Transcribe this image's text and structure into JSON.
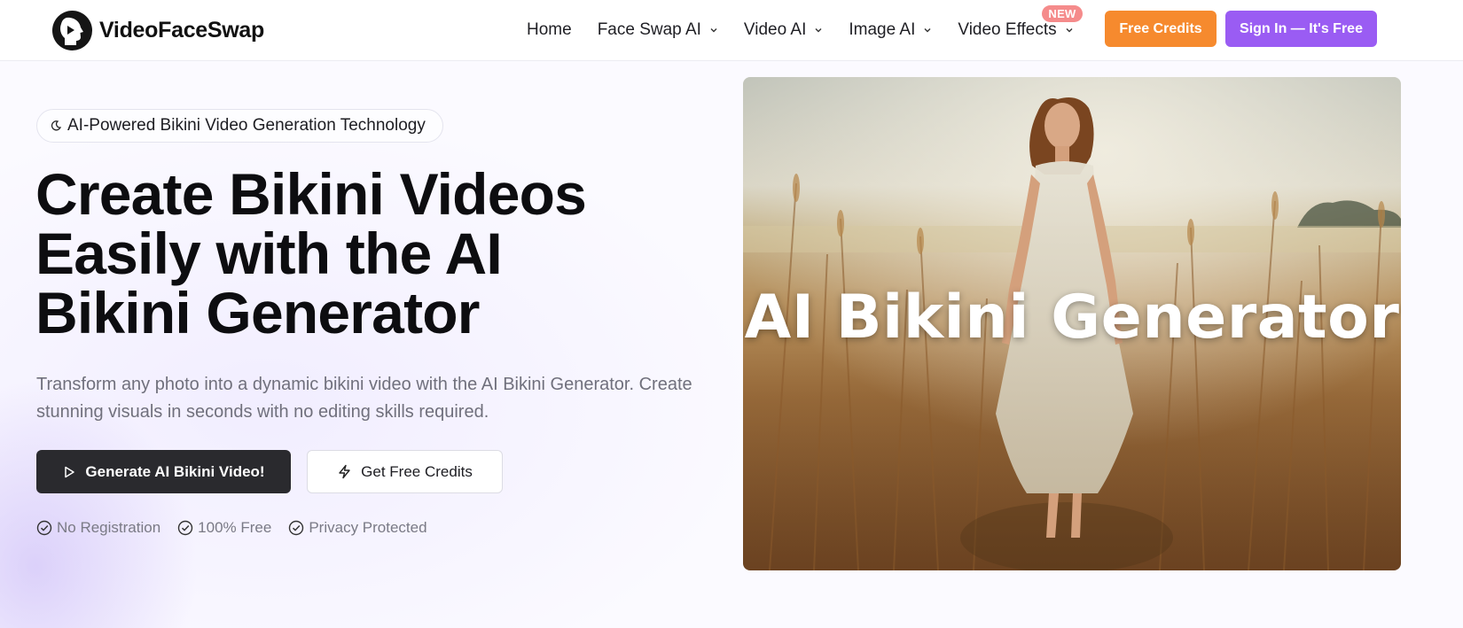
{
  "brand": {
    "name": "VideoFaceSwap"
  },
  "nav": {
    "items": [
      {
        "label": "Home",
        "has_dropdown": false
      },
      {
        "label": "Face Swap AI",
        "has_dropdown": true
      },
      {
        "label": "Video AI",
        "has_dropdown": true
      },
      {
        "label": "Image AI",
        "has_dropdown": true
      },
      {
        "label": "Video Effects",
        "has_dropdown": true,
        "badge": "NEW"
      }
    ],
    "free_credits_label": "Free Credits",
    "sign_in_label": "Sign In — It's Free"
  },
  "hero": {
    "tag": "AI-Powered Bikini Video Generation Technology",
    "title_lines": [
      "Create Bikini Videos",
      "Easily with the AI",
      "Bikini Generator"
    ],
    "subtitle": "Transform any photo into a dynamic bikini video with the AI Bikini Generator. Create stunning visuals in seconds with no editing skills required.",
    "primary_button": "Generate AI Bikini Video!",
    "secondary_button": "Get Free Credits",
    "features": [
      "No Registration",
      "100% Free",
      "Privacy Protected"
    ],
    "image_caption": "AI Bikini Generator"
  },
  "icons": {
    "logo": "face-profile-play-icon",
    "tag": "sparkle-moon-icon",
    "primary_button": "play-icon",
    "secondary_button": "lightning-icon",
    "feature": "check-circle-icon",
    "dropdown": "chevron-down-icon"
  },
  "colors": {
    "free_credits_bg": "#f68a2e",
    "sign_in_bg": "#9a5cf3",
    "new_badge_bg": "#f58b8b",
    "primary_button_bg": "#2a2a2e"
  }
}
